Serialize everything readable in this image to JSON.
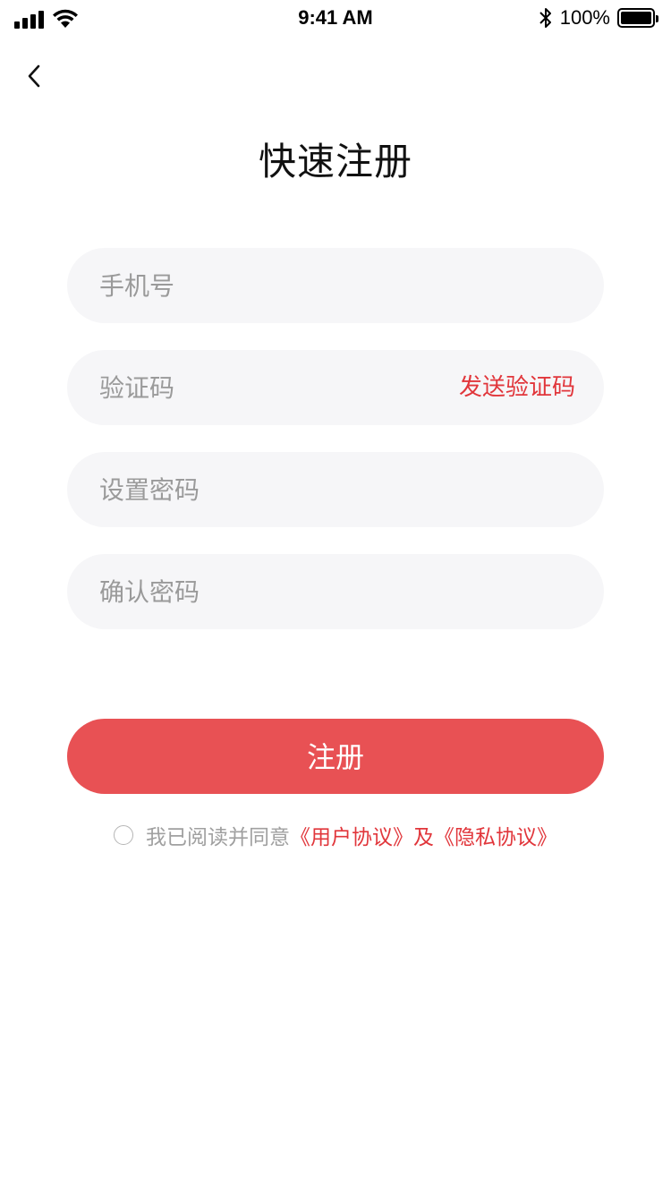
{
  "status_bar": {
    "time": "9:41 AM",
    "battery_percent": "100%",
    "icons": [
      "signal-icon",
      "wifi-icon",
      "bluetooth-icon",
      "battery-icon"
    ]
  },
  "nav": {
    "back_icon": "chevron-left-icon"
  },
  "title": "快速注册",
  "form": {
    "phone_placeholder": "手机号",
    "code_placeholder": "验证码",
    "send_code_label": "发送验证码",
    "password_placeholder": "设置密码",
    "confirm_placeholder": "确认密码"
  },
  "register_label": "注册",
  "agreement": {
    "prefix": "我已阅读并同意",
    "user_agreement": "《用户协议》",
    "and": "及",
    "privacy_policy": "《隐私协议》"
  },
  "colors": {
    "accent": "#e85154",
    "link": "#e1363b",
    "field_bg": "#f6f6f8",
    "placeholder": "#9a9a9a"
  }
}
